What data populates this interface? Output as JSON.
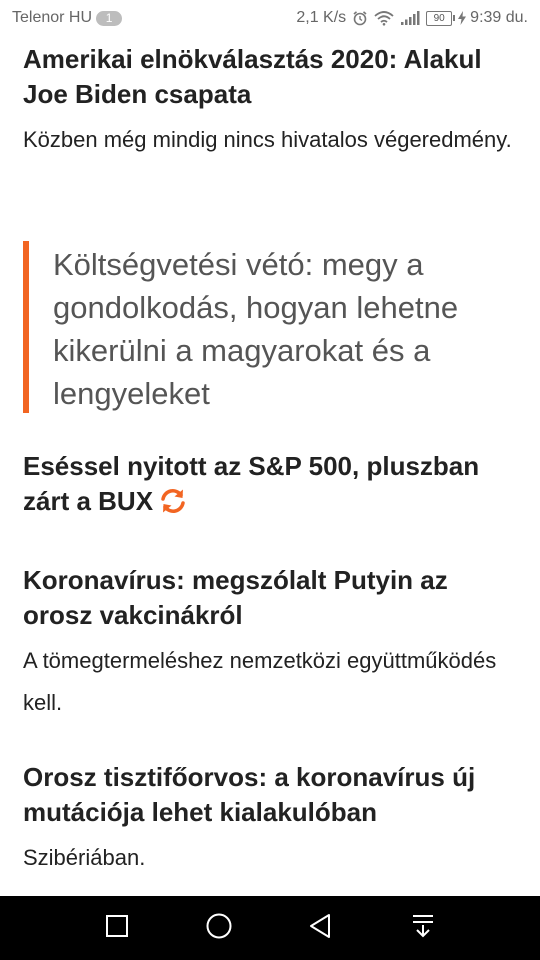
{
  "status_bar": {
    "carrier": "Telenor HU",
    "notification_count": "1",
    "speed": "2,1 K/s",
    "battery": "90",
    "time": "9:39 du."
  },
  "articles": [
    {
      "headline": "Amerikai elnökválasztás 2020: Alakul Joe Biden csapata",
      "lead": "Közben még mindig nincs hivatalos végeredmény."
    },
    {
      "quote": "Költségvetési vétó: megy a gondolkodás, hogyan lehetne kikerülni a magyarokat és a lengyeleket"
    },
    {
      "headline": "Eséssel nyitott az S&P 500, pluszban zárt a BUX",
      "icon": "refresh-icon"
    },
    {
      "headline": "Koronavírus: megszólalt Putyin az orosz vakcinákról",
      "lead": "A tömegtermeléshez nemzetközi együttműködés kell."
    },
    {
      "headline": "Orosz tisztifőorvos: a koronavírus új mutációja lehet kialakulóban",
      "lead": "Szibériában."
    }
  ],
  "colors": {
    "accent": "#f26522",
    "text": "#222222",
    "quote_text": "#555555"
  },
  "nav_bar": {
    "icons": [
      "square-icon",
      "circle-icon",
      "triangle-back-icon",
      "notification-pull-icon"
    ]
  }
}
